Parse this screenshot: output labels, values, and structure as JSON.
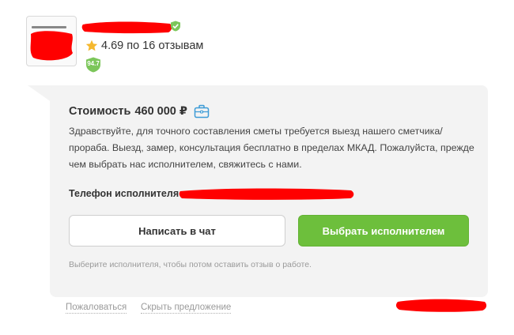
{
  "seller": {
    "rating_value": "4.69",
    "rating_text": "по 16 отзывам",
    "level": "94.7"
  },
  "offer": {
    "price_label": "Стоимость",
    "price_value": "460 000 ₽",
    "message": "Здравствуйте, для точного составления сметы требуется выезд нашего сметчика/прораба. Выезд, замер, консультация бесплатно в пределах МКАД. Пожалуйста, прежде чем выбрать нас исполнителем, свяжитесь с нами.",
    "phone_label": "Телефон исполнителя",
    "chat_button": "Написать в чат",
    "choose_button": "Выбрать исполнителем",
    "hint": "Выберите исполнителя, чтобы потом оставить отзыв о работе."
  },
  "footer": {
    "report_link": "Пожаловаться",
    "hide_link": "Скрыть предложение"
  },
  "colors": {
    "accent_green": "#6dbf3c",
    "star": "#f5b82e",
    "redaction": "#ff0000",
    "badge_green": "#7cc65a"
  },
  "icons": [
    "verified-shield-icon",
    "star-icon",
    "level-badge-icon",
    "briefcase-icon"
  ]
}
